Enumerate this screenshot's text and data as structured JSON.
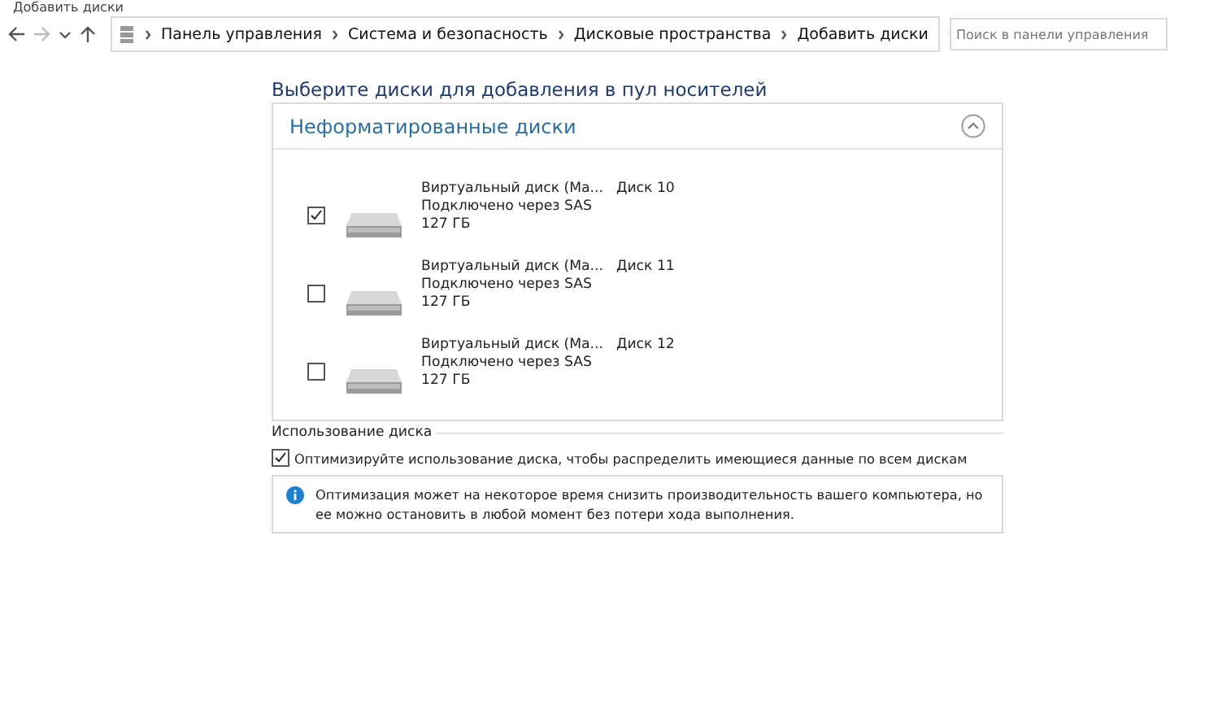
{
  "window": {
    "title": "Добавить диски"
  },
  "address_bar": {
    "breadcrumbs": [
      "Панель управления",
      "Система и безопасность",
      "Дисковые пространства",
      "Добавить диски"
    ],
    "search": {
      "placeholder": "Поиск в панели управления"
    }
  },
  "heading": "Выберите диски для добавления в пул носителей",
  "group": {
    "title": "Неформатированные диски",
    "expanded": true,
    "disks": [
      {
        "name": "Виртуальный диск (Ма...",
        "connection": "Подключено через SAS",
        "size": "127 ГБ",
        "number": "Диск 10",
        "checked": true
      },
      {
        "name": "Виртуальный диск (Ма...",
        "connection": "Подключено через SAS",
        "size": "127 ГБ",
        "number": "Диск 11",
        "checked": false
      },
      {
        "name": "Виртуальный диск (Ма...",
        "connection": "Подключено через SAS",
        "size": "127 ГБ",
        "number": "Диск 12",
        "checked": false
      }
    ]
  },
  "usage": {
    "title": "Использование диска",
    "option": {
      "label": "Оптимизируйте использование диска, чтобы распределить имеющиеся данные по всем дискам",
      "checked": true
    },
    "info": "Оптимизация может на некоторое время снизить производительность вашего компьютера, но ее можно остановить в любой момент без потери хода выполнения."
  }
}
